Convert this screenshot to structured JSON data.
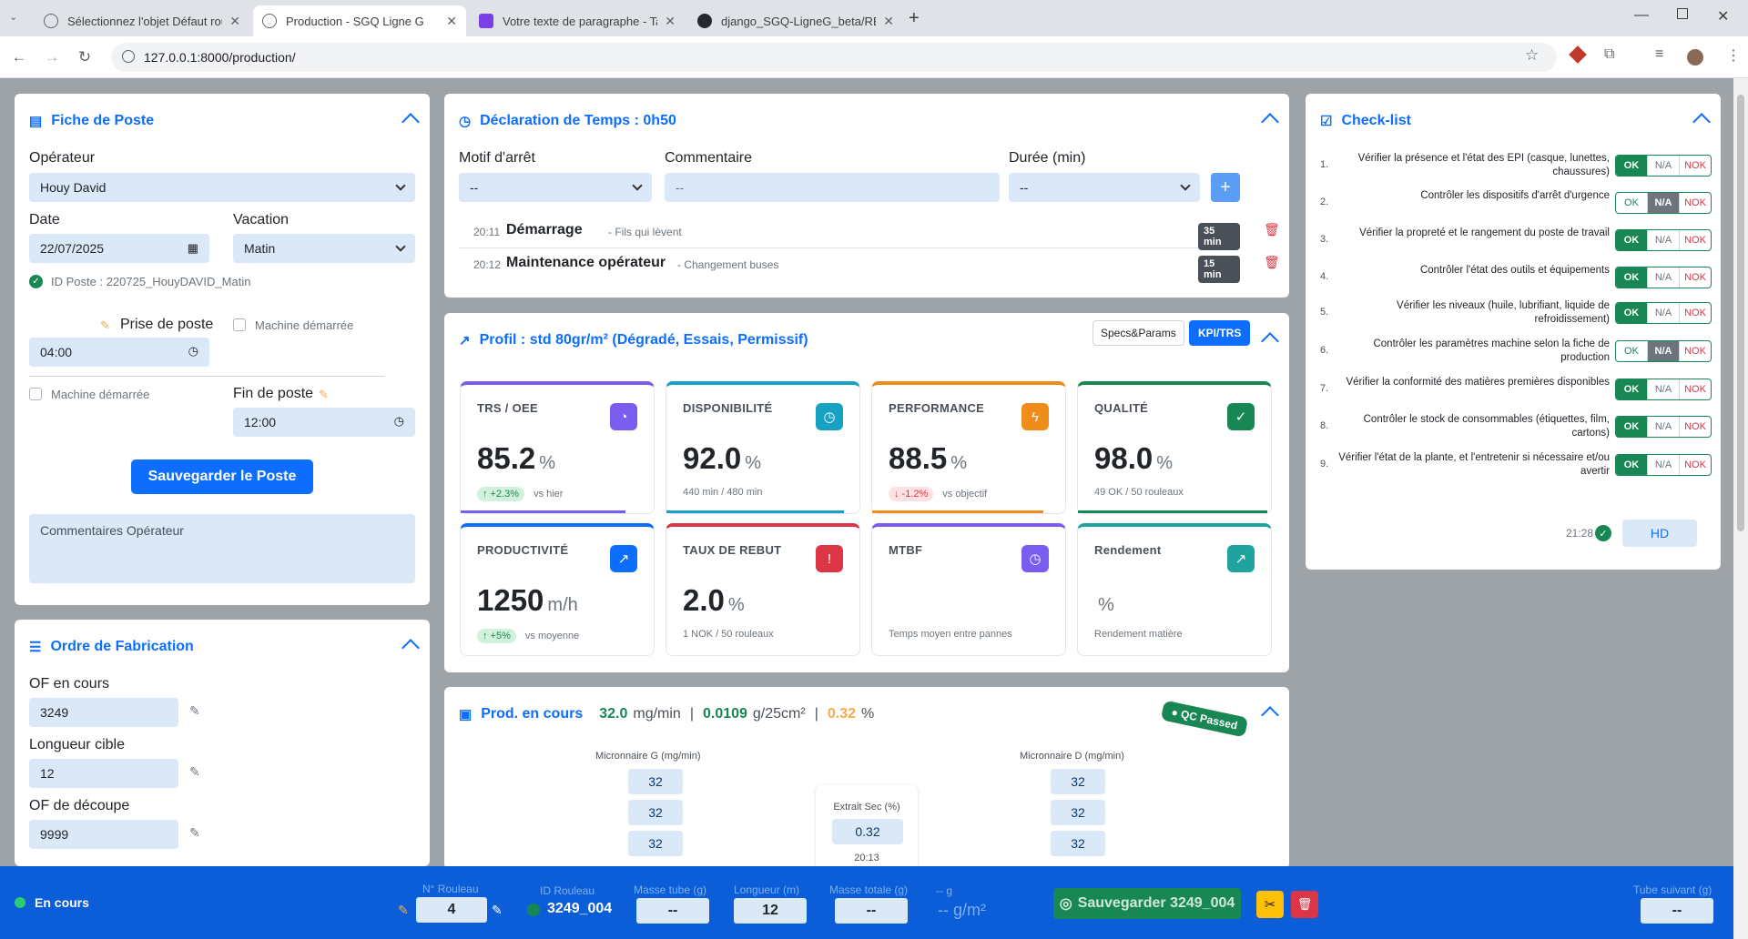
{
  "browser": {
    "tabs": [
      {
        "title": "Sélectionnez l'objet Défaut roul"
      },
      {
        "title": "Production - SGQ Ligne G"
      },
      {
        "title": "Votre texte de paragraphe - Tab"
      },
      {
        "title": "django_SGQ-LigneG_beta/READ"
      }
    ],
    "new_tab": "+",
    "url": "127.0.0.1:8000/production/"
  },
  "fiche": {
    "title": "Fiche de Poste",
    "operateur_label": "Opérateur",
    "operateur_value": "Houy David",
    "date_label": "Date",
    "date_value": "22/07/2025",
    "vacation_label": "Vacation",
    "vacation_value": "Matin",
    "id_poste": "ID Poste : 220725_HouyDAVID_Matin",
    "prise_label": "Prise de poste",
    "prise_value": "04:00",
    "machine_demarree": "Machine démarrée",
    "fin_label": "Fin de poste",
    "fin_value": "12:00",
    "save_button": "Sauvegarder le Poste",
    "comment_placeholder": "Commentaires Opérateur"
  },
  "of": {
    "title": "Ordre de Fabrication",
    "of_label": "OF en cours",
    "of_value": "3249",
    "longueur_label": "Longueur cible",
    "longueur_value": "12",
    "decoupe_label": "OF de découpe",
    "decoupe_value": "9999"
  },
  "temps": {
    "title": "Déclaration de Temps : 0h50",
    "motif_label": "Motif d'arrêt",
    "motif_value": "--",
    "comment_label": "Commentaire",
    "comment_placeholder": "--",
    "duree_label": "Durée (min)",
    "duree_value": "--",
    "add_button": "+",
    "entries": [
      {
        "time": "20:11",
        "title": "Démarrage",
        "detail": "- Fils qui lèvent",
        "duration": "35 min"
      },
      {
        "time": "20:12",
        "title": "Maintenance opérateur",
        "detail": "- Changement buses",
        "duration": "15 min"
      }
    ]
  },
  "profil": {
    "title": "Profil : std 80gr/m² (Dégradé, Essais, Permissif)",
    "specs_button": "Specs&Params",
    "kpi_button": "KPI/TRS",
    "kpis": [
      {
        "title": "TRS / OEE",
        "value": "85.2",
        "unit": "%",
        "pill": "↑ +2.3%",
        "pill_type": "up",
        "sub": "vs hier",
        "color": "#7b5cf0",
        "icon": "gauge-icon",
        "glyph": "◔",
        "progress": 0.852
      },
      {
        "title": "DISPONIBILITÉ",
        "value": "92.0",
        "unit": "%",
        "pill": "",
        "pill_type": "",
        "sub": "440 min / 480 min",
        "color": "#17a2c4",
        "icon": "clock-icon",
        "glyph": "◷",
        "progress": 0.92
      },
      {
        "title": "PERFORMANCE",
        "value": "88.5",
        "unit": "%",
        "pill": "↓ -1.2%",
        "pill_type": "dn",
        "sub": "vs objectif",
        "color": "#f08c1a",
        "icon": "lightning-icon",
        "glyph": "ϟ",
        "progress": 0.885
      },
      {
        "title": "QUALITÉ",
        "value": "98.0",
        "unit": "%",
        "pill": "",
        "pill_type": "",
        "sub": "49 OK / 50 rouleaux",
        "color": "#198754",
        "icon": "check-circle-icon",
        "glyph": "✓",
        "progress": 0.98
      },
      {
        "title": "PRODUCTIVITÉ",
        "value": "1250",
        "unit": "m/h",
        "pill": "↑ +5%",
        "pill_type": "up",
        "sub": "vs moyenne",
        "color": "#0d6efd",
        "icon": "chart-line-icon",
        "glyph": "↗",
        "progress": 1
      },
      {
        "title": "TAUX DE REBUT",
        "value": "2.0",
        "unit": "%",
        "pill": "",
        "pill_type": "",
        "sub": "1 NOK / 50 rouleaux",
        "color": "#dc3545",
        "icon": "warning-icon",
        "glyph": "!",
        "progress": 1
      },
      {
        "title": "MTBF",
        "value": "",
        "unit": "",
        "pill": "",
        "pill_type": "",
        "sub": "Temps moyen entre pannes",
        "color": "#7b5cf0",
        "icon": "clock-icon",
        "glyph": "◷",
        "progress": 1
      },
      {
        "title": "Rendement",
        "value": "",
        "unit": "%",
        "pill": "",
        "pill_type": "",
        "sub": "Rendement matière",
        "color": "#20a39e",
        "icon": "chart-line-icon",
        "glyph": "↗",
        "progress": 1
      }
    ]
  },
  "prod": {
    "title": "Prod. en cours",
    "grammage_value": "32.0",
    "grammage_unit": "mg/min",
    "sep": "|",
    "ratio_value": "0.0109",
    "ratio_unit": "g/25cm²",
    "extrait_value": "0.32",
    "extrait_unit": "%",
    "qc_badge": "QC Passed",
    "micro_g_label": "Micronnaire G (mg/min)",
    "micro_g_values": [
      "32",
      "32",
      "32"
    ],
    "micro_d_label": "Micronnaire D (mg/min)",
    "micro_d_values": [
      "32",
      "32",
      "32"
    ],
    "extrait_label": "Extrait Sec (%)",
    "extrait_box_value": "0.32",
    "extrait_time": "20:13"
  },
  "checklist": {
    "title": "Check-list",
    "ok": "OK",
    "na": "N/A",
    "nok": "NOK",
    "items": [
      {
        "num": "1.",
        "text": "Vérifier la présence et l'état des EPI (casque, lunettes, chaussures)",
        "state": "ok"
      },
      {
        "num": "2.",
        "text": "Contrôler les dispositifs d'arrêt d'urgence",
        "state": "na"
      },
      {
        "num": "3.",
        "text": "Vérifier la propreté et le rangement du poste de travail",
        "state": "ok"
      },
      {
        "num": "4.",
        "text": "Contrôler l'état des outils et équipements",
        "state": "ok"
      },
      {
        "num": "5.",
        "text": "Vérifier les niveaux (huile, lubrifiant, liquide de refroidissement)",
        "state": "ok"
      },
      {
        "num": "6.",
        "text": "Contrôler les paramètres machine selon la fiche de production",
        "state": "na"
      },
      {
        "num": "7.",
        "text": "Vérifier la conformité des matières premières disponibles",
        "state": "ok"
      },
      {
        "num": "8.",
        "text": "Contrôler le stock de consommables (étiquettes, film, cartons)",
        "state": "ok"
      },
      {
        "num": "9.",
        "text": "Vérifier l'état de la plante, et l'entretenir si nécessaire et/ou avertir",
        "state": "ok"
      }
    ],
    "time": "21:28",
    "initials": "HD"
  },
  "bottom": {
    "status": "En cours",
    "rouleau_label": "N° Rouleau",
    "rouleau_value": "4",
    "id_label": "ID Rouleau",
    "id_value": "3249_004",
    "masse_tube_label": "Masse tube (g)",
    "masse_tube_value": "--",
    "longueur_label": "Longueur (m)",
    "longueur_value": "12",
    "masse_totale_label": "Masse totale (g)",
    "masse_totale_value": "--",
    "g_label": "-- g",
    "gm2_value": "-- g/m²",
    "save_button": "Sauvegarder 3249_004",
    "tube_label": "Tube suivant (g)",
    "tube_value": "--"
  },
  "colors": {
    "primary": "#0d6efd",
    "success": "#198754",
    "danger": "#dc3545",
    "bottom_bar": "#0b5ed7"
  }
}
